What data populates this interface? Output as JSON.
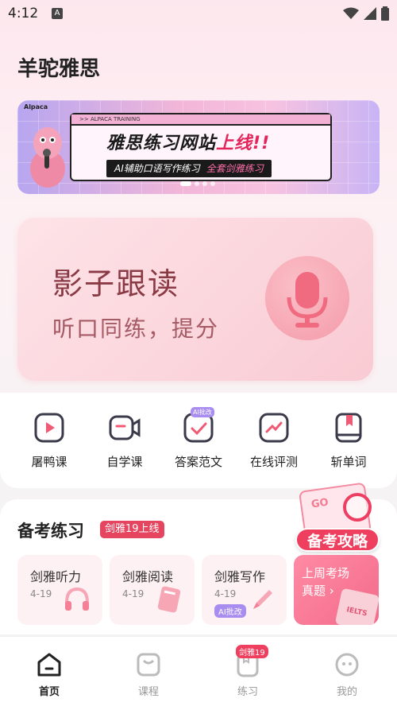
{
  "status_bar": {
    "time": "4:12",
    "notification_letter": "A"
  },
  "app": {
    "title": "羊驼雅思"
  },
  "banner": {
    "brand": "Alpaca",
    "window_caption": ">> ALPACA TRAINING",
    "headline_prefix": "雅思练习网站",
    "headline_highlight": "上线",
    "headline_mark": "!!",
    "tag_primary": "AI辅助口语写作练习",
    "tag_secondary": "全套剑雅练习"
  },
  "shadow_reading": {
    "title": "影子跟读",
    "subtitle": "听口同练，提分"
  },
  "quick_actions": [
    {
      "label": "屠鸭课",
      "icon": "video-play-icon"
    },
    {
      "label": "自学课",
      "icon": "video-camera-icon"
    },
    {
      "label": "答案范文",
      "icon": "check-document-icon",
      "badge": "AI批改"
    },
    {
      "label": "在线评测",
      "icon": "chart-trend-icon"
    },
    {
      "label": "斩单词",
      "icon": "bookmark-book-icon"
    }
  ],
  "practice": {
    "title": "备考练习",
    "badge": "剑雅19上线",
    "promo_label": "备考攻略",
    "promo_doc_text": "GO",
    "cards": [
      {
        "title": "剑雅听力",
        "range": "4-19",
        "icon": "headphones-icon"
      },
      {
        "title": "剑雅阅读",
        "range": "4-19",
        "icon": "book-icon"
      },
      {
        "title": "剑雅写作",
        "range": "4-19",
        "icon": "pen-icon",
        "badge": "AI批改"
      }
    ],
    "exam_card": {
      "title": "上周考场",
      "subtitle": "真题",
      "book_text": "IELTS"
    }
  },
  "bottom_nav": [
    {
      "label": "首页",
      "icon": "home-icon",
      "active": true
    },
    {
      "label": "课程",
      "icon": "course-bag-icon",
      "active": false
    },
    {
      "label": "练习",
      "icon": "practice-book-icon",
      "active": false,
      "badge": "剑雅19"
    },
    {
      "label": "我的",
      "icon": "profile-face-icon",
      "active": false
    }
  ],
  "colors": {
    "accent": "#ef3f5f",
    "ai_badge": "#a88cf0",
    "icon_stroke": "#3a3a4a"
  }
}
